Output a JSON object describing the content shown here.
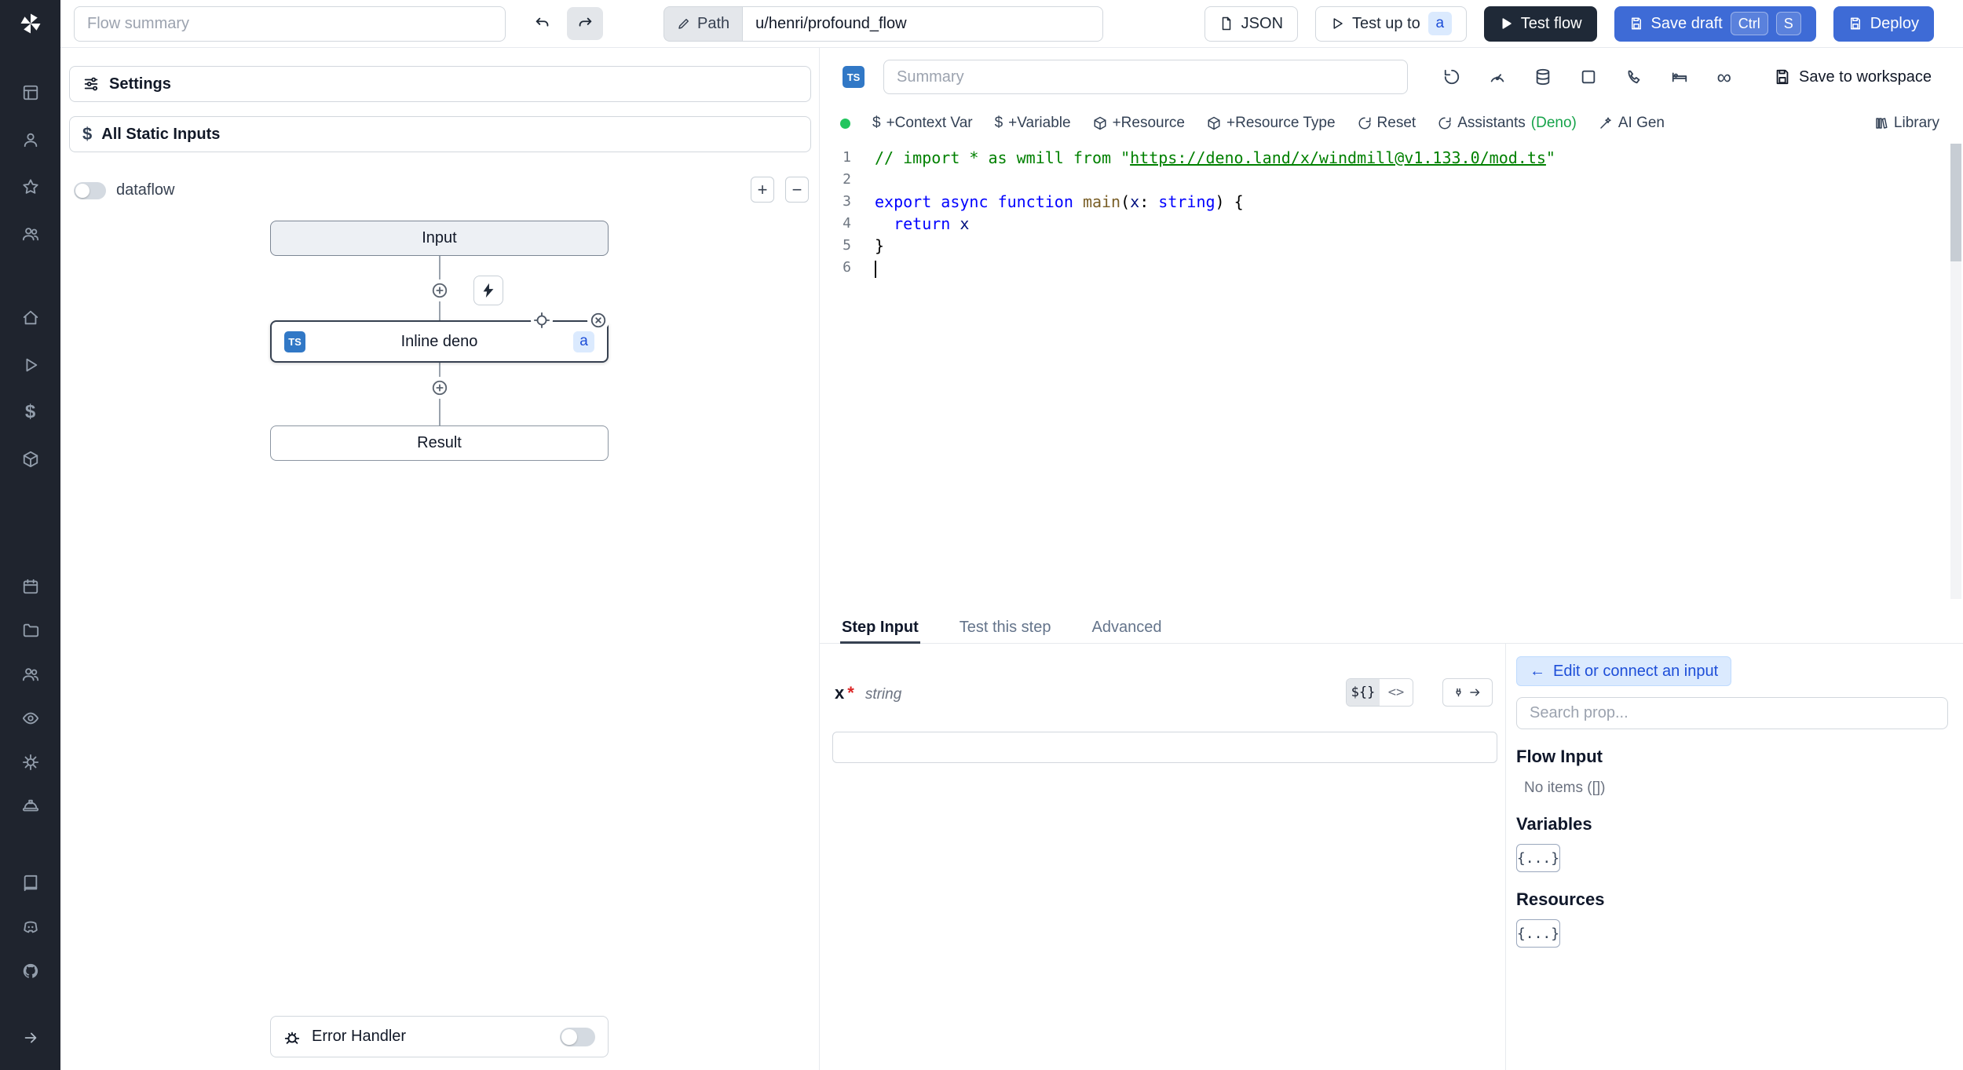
{
  "glyphs": {
    "dollar": "$",
    "back_arrow": "←",
    "infinity": "∞"
  },
  "sidebar": {
    "icon_names": [
      "windmill-logo",
      "grid",
      "user",
      "star",
      "users",
      "home",
      "play",
      "dollar",
      "package",
      "calendar",
      "folder",
      "user-group",
      "eye",
      "settings",
      "worker",
      "docs",
      "discord",
      "github",
      "expand"
    ]
  },
  "topbar": {
    "flow_summary_placeholder": "Flow summary",
    "path_label": "Path",
    "path_value": "u/henri/profound_flow",
    "json_label": "JSON",
    "test_up_to_label": "Test up to",
    "test_up_to_badge": "a",
    "test_flow_label": "Test flow",
    "save_draft_label": "Save draft",
    "kbd": [
      "Ctrl",
      "S"
    ],
    "deploy_label": "Deploy"
  },
  "flow": {
    "settings_label": "Settings",
    "static_inputs_label": "All Static Inputs",
    "dataflow_label": "dataflow",
    "zoom_in": "+",
    "zoom_out": "−",
    "input_node": "Input",
    "inline_node": "Inline deno",
    "inline_badge": "TS",
    "inline_tag": "a",
    "result_node": "Result",
    "error_handler_label": "Error Handler"
  },
  "editor": {
    "lang_badge": "TS",
    "summary_placeholder": "Summary",
    "save_to_workspace": "Save to workspace",
    "toolbar": {
      "context_var": "+Context Var",
      "variable": "+Variable",
      "resource": "+Resource",
      "resource_type": "+Resource Type",
      "reset": "Reset",
      "assistants": "Assistants",
      "assistants_lang": "(Deno)",
      "ai_gen": "AI Gen",
      "library": "Library"
    },
    "code": {
      "lines": [
        {
          "n": 1,
          "tokens": [
            {
              "t": "// import * as wmill from \"",
              "c": "cm"
            },
            {
              "t": "https://deno.land/x/windmill@v1.133.0/mod.ts",
              "c": "link"
            },
            {
              "t": "\"",
              "c": "cm"
            }
          ]
        },
        {
          "n": 2,
          "tokens": []
        },
        {
          "n": 3,
          "tokens": [
            {
              "t": "export",
              "c": "kw"
            },
            {
              "t": " ",
              "c": "pl"
            },
            {
              "t": "async",
              "c": "kw"
            },
            {
              "t": " ",
              "c": "pl"
            },
            {
              "t": "function",
              "c": "kw"
            },
            {
              "t": " ",
              "c": "pl"
            },
            {
              "t": "main",
              "c": "fn"
            },
            {
              "t": "(",
              "c": "pl"
            },
            {
              "t": "x",
              "c": "pm"
            },
            {
              "t": ": ",
              "c": "pl"
            },
            {
              "t": "string",
              "c": "kw"
            },
            {
              "t": ") {",
              "c": "pl"
            }
          ]
        },
        {
          "n": 4,
          "tokens": [
            {
              "t": "  ",
              "c": "pl"
            },
            {
              "t": "return",
              "c": "kw"
            },
            {
              "t": " ",
              "c": "pl"
            },
            {
              "t": "x",
              "c": "pm"
            }
          ]
        },
        {
          "n": 5,
          "tokens": [
            {
              "t": "}",
              "c": "pl"
            }
          ]
        },
        {
          "n": 6,
          "tokens": [],
          "cursor": true
        }
      ]
    }
  },
  "tabs": {
    "step_input": "Step Input",
    "test_this_step": "Test this step",
    "advanced": "Advanced"
  },
  "step_input": {
    "field_name": "x",
    "required_mark": "*",
    "field_type": "string",
    "expr_button": "${}",
    "code_button": "<>",
    "value": ""
  },
  "connect_panel": {
    "edit_button": "Edit or connect an input",
    "search_placeholder": "Search prop...",
    "flow_input_title": "Flow Input",
    "no_items": "No items ([])",
    "variables_title": "Variables",
    "variables_chip": "{...}",
    "resources_title": "Resources",
    "resources_chip": "{...}"
  },
  "colors": {
    "primary_blue": "#3e6bd6",
    "dark_button": "#1f2937",
    "badge_blue_bg": "#dbeafe",
    "badge_blue_text": "#1d4ed8",
    "status_green": "#22c55e",
    "deno_green": "#16a34a",
    "ts_badge_blue": "#3178c6",
    "sidebar_bg": "#1f242e"
  }
}
